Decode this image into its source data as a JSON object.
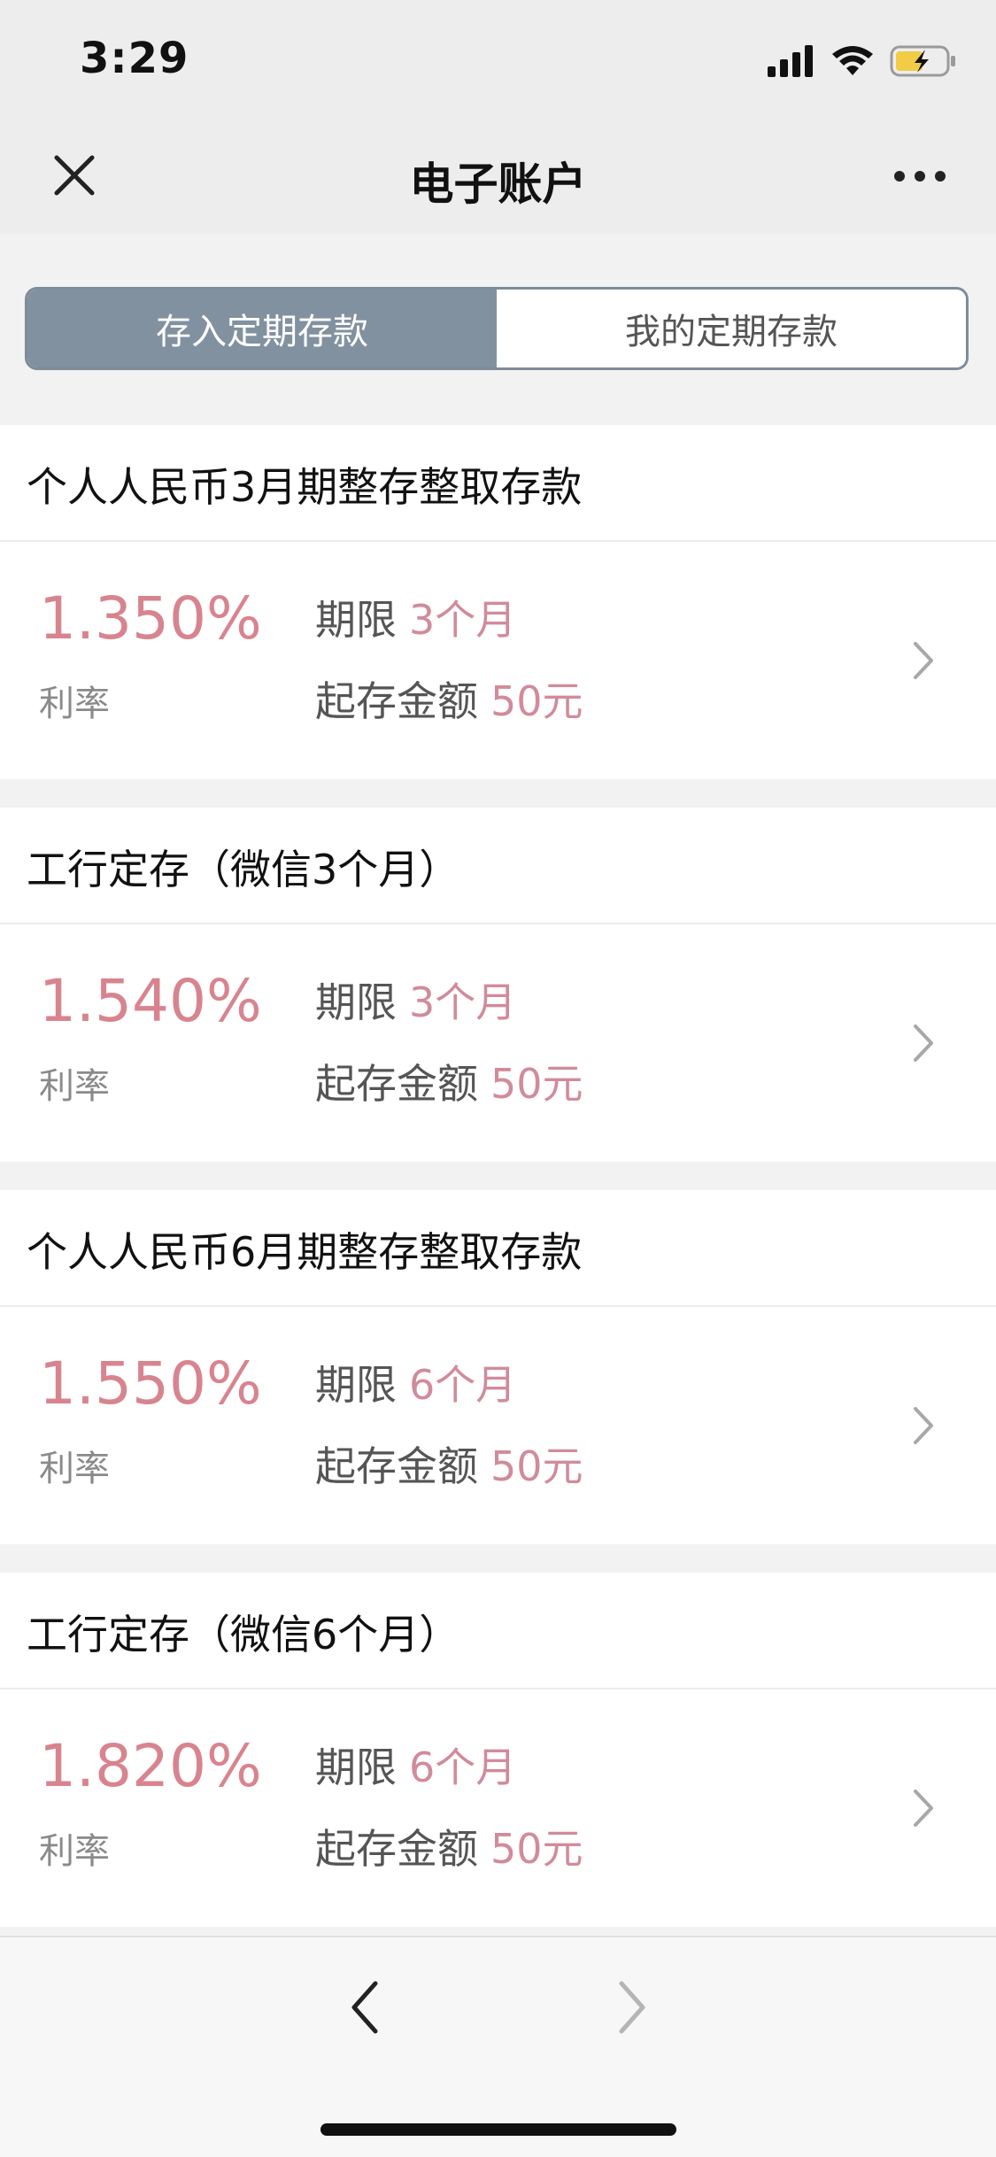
{
  "status_bar": {
    "time": "3:29"
  },
  "nav": {
    "title": "电子账户",
    "close_icon": "close-icon",
    "more_icon": "more-dots-icon"
  },
  "segment": {
    "tabs": [
      {
        "label": "存入定期存款",
        "active": true
      },
      {
        "label": "我的定期存款",
        "active": false
      }
    ]
  },
  "labels": {
    "rate": "利率",
    "term": "期限",
    "min_amount": "起存金额"
  },
  "products": [
    {
      "name": "个人人民币3月期整存整取存款",
      "rate": "1.350%",
      "term": "3个月",
      "min_amount": "50元"
    },
    {
      "name": "工行定存（微信3个月）",
      "rate": "1.540%",
      "term": "3个月",
      "min_amount": "50元"
    },
    {
      "name": "个人人民币6月期整存整取存款",
      "rate": "1.550%",
      "term": "6个月",
      "min_amount": "50元"
    },
    {
      "name": "工行定存（微信6个月）",
      "rate": "1.820%",
      "term": "6个月",
      "min_amount": "50元"
    }
  ],
  "colors": {
    "accent_pink": "#D8848F",
    "segment_active": "#8291A0",
    "background": "#F2F2F2"
  }
}
